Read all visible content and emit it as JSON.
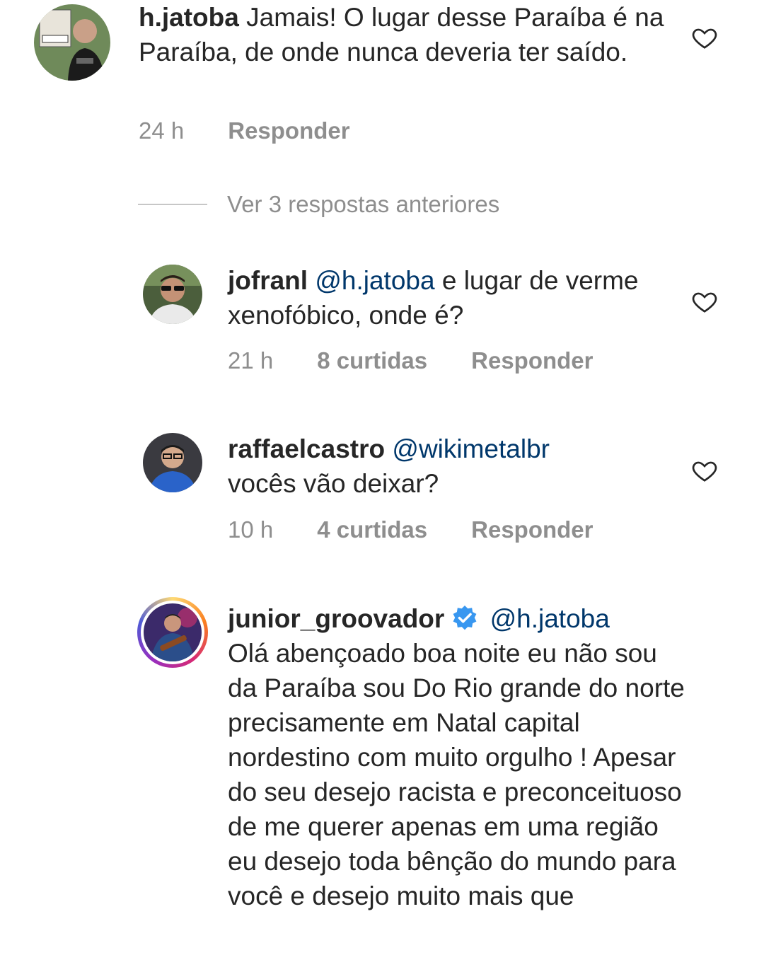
{
  "comments": [
    {
      "username": "h.jatoba",
      "mention": "",
      "text": "Jamais! O lugar desse Paraíba é na Paraíba, de onde nunca deveria ter saído.",
      "time": "24 h",
      "likes": "",
      "reply_label": "Responder"
    },
    {
      "username": "jofranl",
      "mention": "@h.jatoba",
      "text": "e lugar de verme xenofóbico, onde é?",
      "time": "21 h",
      "likes": "8 curtidas",
      "reply_label": "Responder"
    },
    {
      "username": "raffaelcastro",
      "mention": "@wikimetalbr",
      "text": "vocês vão deixar?",
      "time": "10 h",
      "likes": "4 curtidas",
      "reply_label": "Responder"
    },
    {
      "username": "junior_groovador",
      "mention": "@h.jatoba",
      "text": "Olá abençoado boa noite eu não sou da Paraíba sou Do Rio grande do norte precisamente em Natal capital nordestino com muito orgulho ! Apesar do seu desejo racista e preconceituoso de me querer apenas em uma região eu desejo toda bênção do mundo para você e desejo muito mais que",
      "verified": true
    }
  ],
  "replies_toggle": "Ver 3 respostas anteriores",
  "icons": {
    "like": "heart-outline-icon",
    "verified": "verified-badge-icon"
  },
  "colors": {
    "text": "#262626",
    "muted": "#8e8e8e",
    "mention": "#00376b",
    "verified": "#3897f0"
  }
}
